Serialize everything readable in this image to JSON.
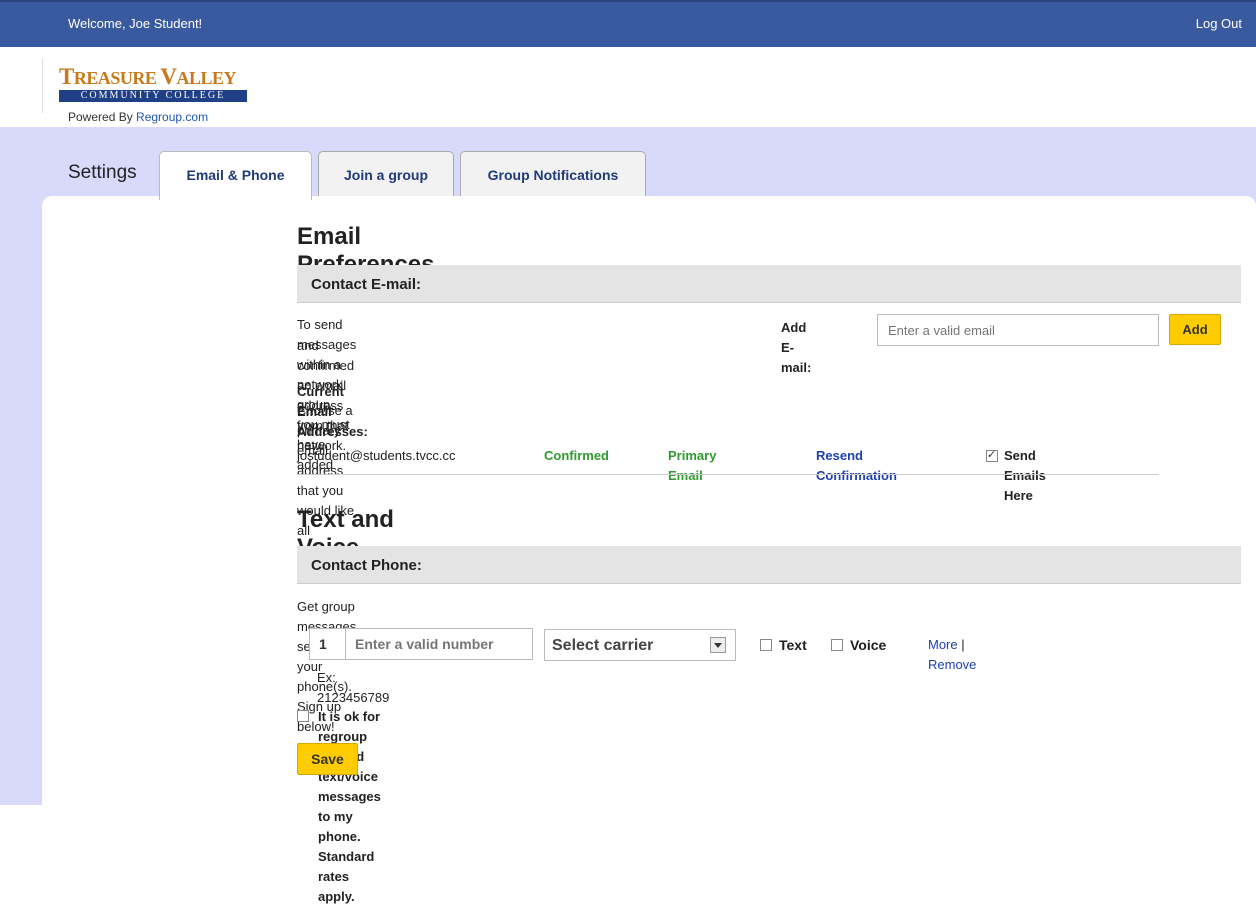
{
  "topbar": {
    "welcome": "Welcome, Joe Student!",
    "logout": "Log Out"
  },
  "logo": {
    "line1_big1": "T",
    "line1_small1": "REASURE ",
    "line1_big2": "V",
    "line1_small2": "ALLEY",
    "line2": "COMMUNITY COLLEGE",
    "powered_prefix": "Powered By",
    "powered_link": "Regroup.com"
  },
  "nav": {
    "settings_label": "Settings",
    "tabs": [
      {
        "label": "Email & Phone",
        "active": true
      },
      {
        "label": "Join a group",
        "active": false
      },
      {
        "label": "Group Notifications",
        "active": false
      }
    ]
  },
  "email": {
    "heading": "Email Preferences",
    "section_title": "Contact E-mail:",
    "intro_line1": "To send messages within a network group, you must have added",
    "intro_line2": "and confirmed an email address from that network.",
    "add_label": "Add E-mail:",
    "add_placeholder": "Enter a valid email",
    "add_button": "Add",
    "current_title": "Current Email Addresses:",
    "current_desc": "Choose a primary email address that you would like all messages sent to:",
    "entries": [
      {
        "address": "jostudent@students.tvcc.cc",
        "status": "Confirmed",
        "primary": "Primary Email",
        "resend": "Resend Confirmation",
        "send_here": "Send Emails Here",
        "send_checked": true
      }
    ]
  },
  "phone": {
    "heading": "Text and Voice Preferences",
    "section_title": "Contact Phone:",
    "intro": "Get group messages sent to your phone(s). Sign up below!",
    "country_code": "1",
    "number_placeholder": "Enter a valid number",
    "carrier": "Select carrier",
    "text_label": "Text",
    "voice_label": "Voice",
    "more": "More",
    "separator": "|",
    "remove": "Remove",
    "example": "Ex: 2123456789",
    "consent": "It is ok for regroup to send text/voice messages to my phone. Standard rates apply.",
    "save_button": "Save"
  },
  "colors": {
    "topbar": "#3a5aa0",
    "band": "#d9d9fb",
    "button": "#ffcc00",
    "confirmed": "#2e9b2e",
    "link": "#1f40b3"
  }
}
